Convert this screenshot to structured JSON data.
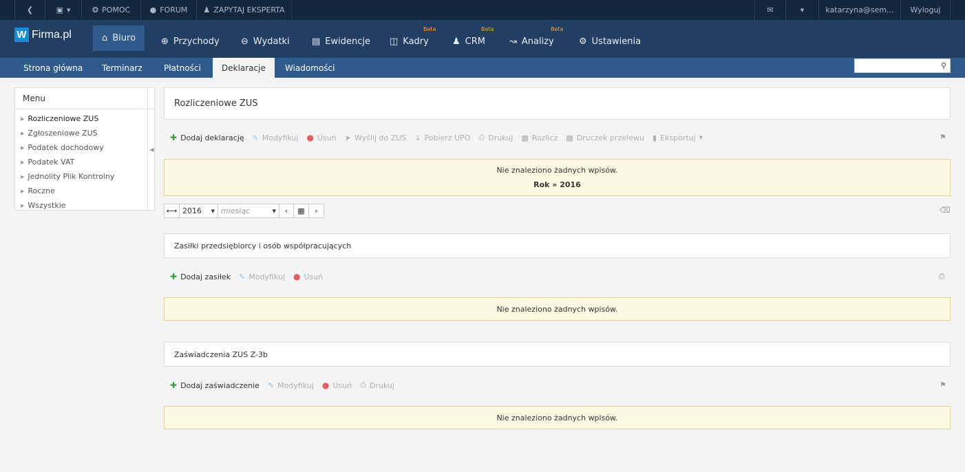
{
  "topbar": {
    "back_icon": "circle-arrow-left-icon",
    "image_icon": "image-dropdown-icon",
    "help": "POMOC",
    "forum": "FORUM",
    "expert": "ZAPYTAJ EKSPERTA",
    "mail_icon": "envelope-icon",
    "user": "katarzyna@sem...",
    "logout": "Wyloguj"
  },
  "logo": {
    "letter": "W",
    "text": "Firma.pl"
  },
  "mainnav": [
    {
      "label": "Biuro"
    },
    {
      "label": "Przychody"
    },
    {
      "label": "Wydatki"
    },
    {
      "label": "Ewidencje"
    },
    {
      "label": "Kadry",
      "badge": "Beta"
    },
    {
      "label": "CRM",
      "badge": "Beta"
    },
    {
      "label": "Analizy",
      "badge": "Beta"
    },
    {
      "label": "Ustawienia"
    }
  ],
  "subnav": [
    {
      "label": "Strona główna"
    },
    {
      "label": "Terminarz"
    },
    {
      "label": "Płatności"
    },
    {
      "label": "Deklaracje"
    },
    {
      "label": "Wiadomości"
    }
  ],
  "search": {
    "placeholder": ""
  },
  "menu": {
    "title": "Menu",
    "items": [
      {
        "label": "Rozliczeniowe ZUS"
      },
      {
        "label": "Zgłoszeniowe ZUS"
      },
      {
        "label": "Podatek dochodowy"
      },
      {
        "label": "Podatek VAT"
      },
      {
        "label": "Jednolity Plik Kontrolny"
      },
      {
        "label": "Roczne"
      },
      {
        "label": "Wszystkie"
      }
    ]
  },
  "section1": {
    "title": "Rozliczeniowe ZUS",
    "actions": {
      "add": "Dodaj deklarację",
      "modify": "Modyfikuj",
      "delete": "Usuń",
      "send": "Wyślij do ZUS",
      "download": "Pobierz UPO",
      "print": "Drukuj",
      "settle": "Rozlicz",
      "transfer": "Druczek przelewu",
      "export": "Eksportuj"
    },
    "alert": "Nie znaleziono żadnych wpisów.",
    "filter_note": "Rok » 2016",
    "year": "2016",
    "month_placeholder": "miesiąc"
  },
  "section2": {
    "title": "Zasiłki przedsiębiorcy i osób współpracujących",
    "actions": {
      "add": "Dodaj zasiłek",
      "modify": "Modyfikuj",
      "delete": "Usuń"
    },
    "alert": "Nie znaleziono żadnych wpisów."
  },
  "section3": {
    "title": "Zaświadczenia ZUS Z-3b",
    "actions": {
      "add": "Dodaj zaświadczenie",
      "modify": "Modyfikuj",
      "delete": "Usuń",
      "print": "Drukuj"
    },
    "alert": "Nie znaleziono żadnych wpisów."
  },
  "colors": {
    "topbar": "#14283d",
    "mainnav": "#223f63",
    "subnav": "#2f5b8c",
    "beta": "#f0a03a",
    "alert_bg": "#fcf9e3",
    "add_green": "#3aa03a"
  }
}
